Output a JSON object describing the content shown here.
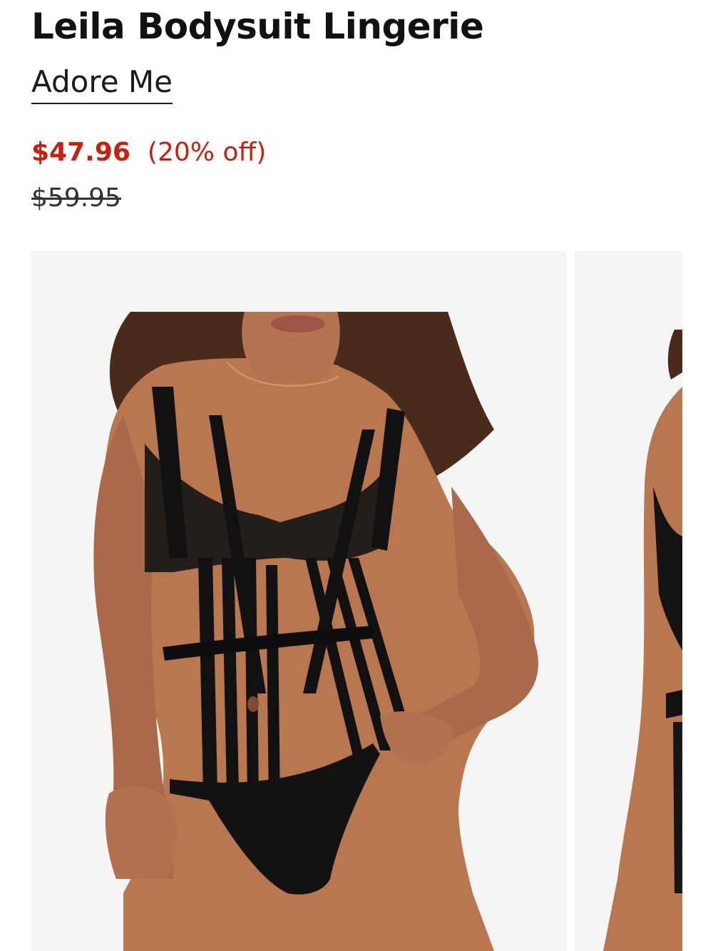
{
  "product": {
    "title": "Leila Bodysuit Lingerie",
    "brand": "Adore Me"
  },
  "pricing": {
    "current_price": "$47.96",
    "discount": "(20% off)",
    "original_price": "$59.95"
  },
  "gallery": {
    "image_count_visible": 2
  },
  "colors": {
    "price_red": "#c7200c",
    "text": "#1b1b1b",
    "image_background": "#f5f5f5",
    "skin": "#b8774f",
    "garment": "#111111",
    "hair": "#4a2a1a"
  }
}
